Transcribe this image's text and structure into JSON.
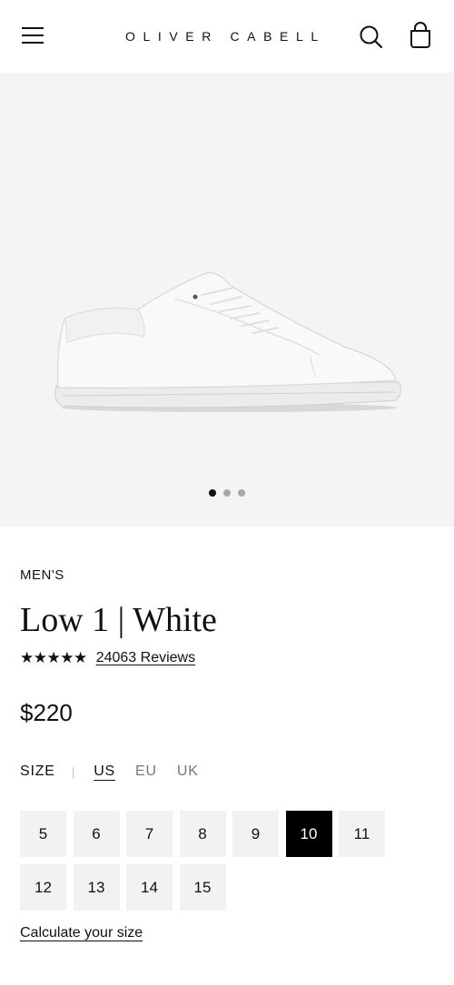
{
  "header": {
    "brand": "OLIVER CABELL",
    "icons": {
      "menu": "menu-icon",
      "search": "search-icon",
      "bag": "shopping-bag-icon"
    }
  },
  "gallery": {
    "image": "white-low-top-sneaker",
    "slide_count": 3,
    "active_slide": 1
  },
  "product": {
    "category": "MEN'S",
    "title": "Low 1 | White",
    "rating": 5,
    "stars": "★★★★★",
    "reviews_label": "24063 Reviews",
    "price": "$220"
  },
  "size": {
    "label": "SIZE",
    "separator": "|",
    "units": [
      "US",
      "EU",
      "UK"
    ],
    "active_unit": "US",
    "options": [
      "5",
      "6",
      "7",
      "8",
      "9",
      "10",
      "11",
      "12",
      "13",
      "14",
      "15"
    ],
    "selected": "10",
    "calculator_label": "Calculate your size"
  },
  "colors": {
    "hero_bg": "#f4f4f4",
    "size_bg": "#f2f2f2",
    "selected_bg": "#000000",
    "text": "#111111"
  }
}
